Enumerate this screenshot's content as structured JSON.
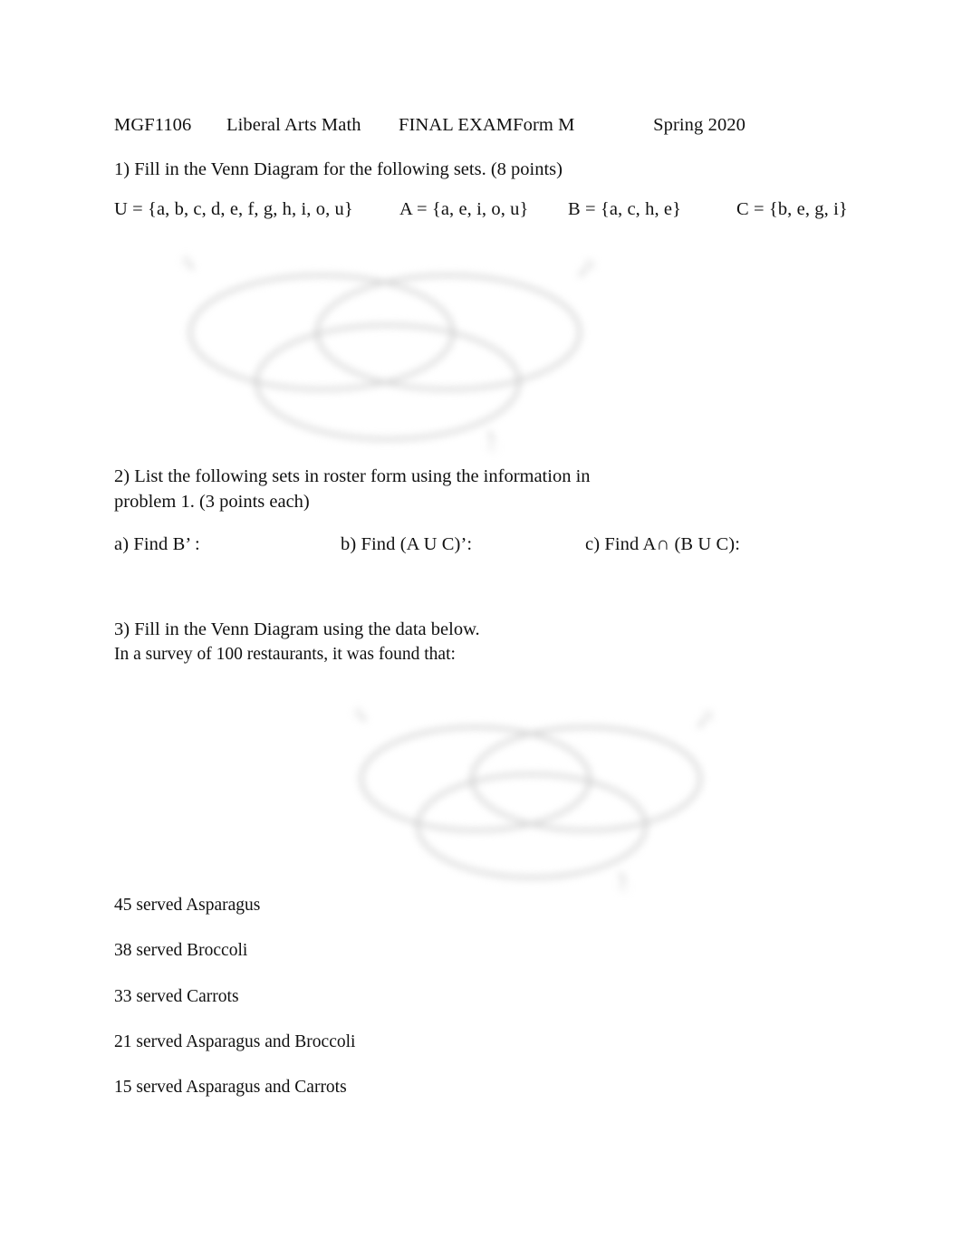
{
  "document": {
    "title": "MGF1106 Liberal Arts Math FINAL EXAM Form M Spring 2020",
    "page_background": "#ffffff",
    "text_color": "#111111"
  },
  "header": {
    "course_code": "MGF1106",
    "course_name": "Liberal Arts Math",
    "exam_name": "FINAL EXAM",
    "form": "Form M",
    "term": "Spring 2020"
  },
  "question1": {
    "prompt": "1) Fill in the Venn Diagram for the following sets. (8 points)",
    "sets": {
      "universe": "U = {a, b, c, d, e, f, g, h, i, o, u}",
      "set_a": "A = {a, e, i, o, u}",
      "set_b": "B = {a, c, h, e}",
      "set_c": "C = {b, e, g, i}"
    },
    "diagram": {
      "name": "venn-diagram-three-circles",
      "stroke_color": "#c9c9c9",
      "labels": [
        "A",
        "B",
        "C"
      ],
      "description": "Three overlapping circles, blurred light gray"
    }
  },
  "question2": {
    "prompt_line1": "2) List the following sets in roster form using the information in",
    "prompt_line2": "problem 1. (3 points each)",
    "parts": [
      {
        "key": "a",
        "text": "a) Find B’ :"
      },
      {
        "key": "b",
        "text": "b) Find (A U C)’:"
      },
      {
        "key": "c",
        "text": "c) Find A∩ (B U C):"
      }
    ]
  },
  "question3": {
    "prompt_line1": "3) Fill in the Venn Diagram using the data below.",
    "prompt_line2": "In a survey of 100 restaurants, it was found that:",
    "diagram": {
      "name": "venn-diagram-three-circles",
      "stroke_color": "#c9c9c9",
      "labels": [
        "A",
        "B",
        "C"
      ],
      "description": "Three overlapping circles, blurred light gray"
    },
    "survey_data": [
      "45 served Asparagus",
      "38 served Broccoli",
      "33 served Carrots",
      "21 served Asparagus and Broccoli",
      "15 served Asparagus and Carrots"
    ]
  }
}
